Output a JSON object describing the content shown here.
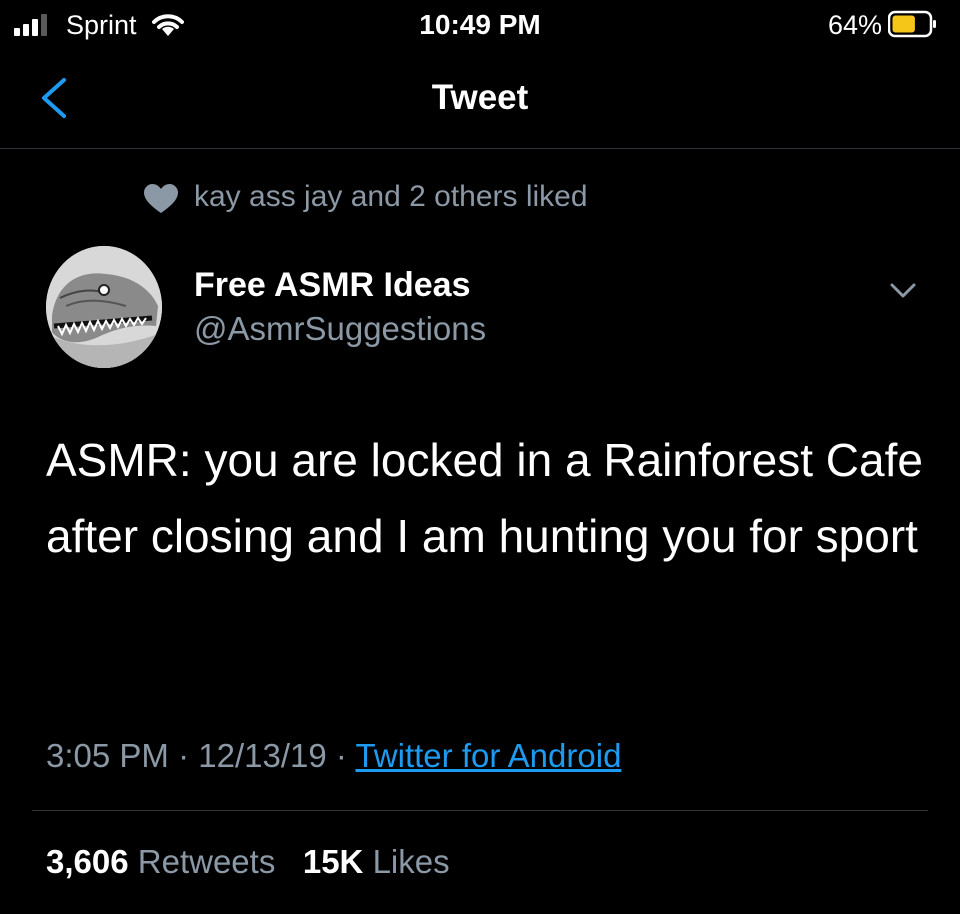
{
  "status_bar": {
    "carrier": "Sprint",
    "time": "10:49 PM",
    "battery_percent": "64%",
    "battery_level": 0.64,
    "battery_color": "#f5c518"
  },
  "nav": {
    "title": "Tweet"
  },
  "social_context": {
    "text": "kay ass jay and 2 others liked"
  },
  "tweet": {
    "display_name": "Free ASMR Ideas",
    "handle": "@AsmrSuggestions",
    "text": "ASMR: you are locked in a Rainforest Cafe after closing and I am hunting you for sport",
    "time": "3:05 PM",
    "date": "12/13/19",
    "separator": "·",
    "source": "Twitter for Android",
    "retweets_count": "3,606",
    "retweets_label": "Retweets",
    "likes_count": "15K",
    "likes_label": "Likes"
  },
  "colors": {
    "background": "#000000",
    "secondary_text": "#8b98a5",
    "link": "#1d9bf0"
  }
}
